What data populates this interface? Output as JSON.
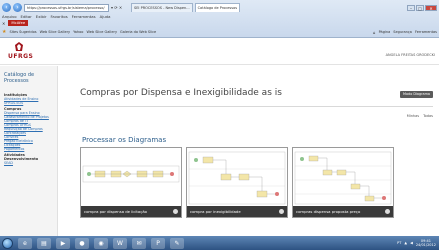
{
  "browser": {
    "address": "https://processos.ufrgs.br/sistema/processo/",
    "tabs": [
      {
        "label": "SEI PROCESSOS - New Dispen...",
        "active": false
      },
      {
        "label": "Catálogo de Processos",
        "active": true
      }
    ],
    "menu": [
      "Arquivo",
      "Editar",
      "Exibir",
      "Favoritos",
      "Ferramentas",
      "Ajuda"
    ],
    "mcafee_label": "McAfee",
    "favorites": [
      "Sites Sugeridos",
      "Web Slice Gallery",
      "Yahoo",
      "Web Slice Gallery",
      "Galeria do Web Slice"
    ],
    "favorites_right": [
      "Página",
      "Segurança",
      "Ferramentas"
    ],
    "icons": {
      "back": "back-arrow-icon",
      "forward": "forward-arrow-icon"
    }
  },
  "header": {
    "logo_text": "UFRGS",
    "user_name": "ANGELA FREITAS GRODECKI"
  },
  "sidebar": {
    "title": "Catálogo de Processos",
    "sections": [
      {
        "heading": "Instituições",
        "links": [
          "Atividades de Ensino",
          "UFRGS-SOS"
        ]
      },
      {
        "heading": "Compras",
        "links": [
          "Dispensa para Ensino",
          "Cadastramento de Projetos",
          "Compras de TI",
          "Compras UFRGS",
          "Requisição de Compras",
          "Contratações",
          "Convites",
          "Pregão Eletrônico",
          "Licitações",
          "Pagamentos"
        ]
      },
      {
        "heading": "Atividades Desenvolvimento",
        "links": [
          "SEAD"
        ]
      }
    ]
  },
  "main": {
    "title": "Compras por Dispensa e Inexigibilidade as is",
    "header_button": "Modo Diagrama",
    "actions": [
      "Minhas",
      "Todas"
    ],
    "section_title": "Processar os Diagramas",
    "cards": [
      {
        "caption": "compra por dispensa de licitação"
      },
      {
        "caption": "compra por inexigibilidade"
      },
      {
        "caption": "compras dispensa proposta preço"
      }
    ]
  },
  "taskbar": {
    "time": "09:41",
    "date": "24/01/2012",
    "language": "PT"
  },
  "colors": {
    "brand": "#a0151c",
    "link": "#2e6fb3",
    "heading": "#2e5f8c",
    "caption_bg": "#3a3a3a"
  }
}
